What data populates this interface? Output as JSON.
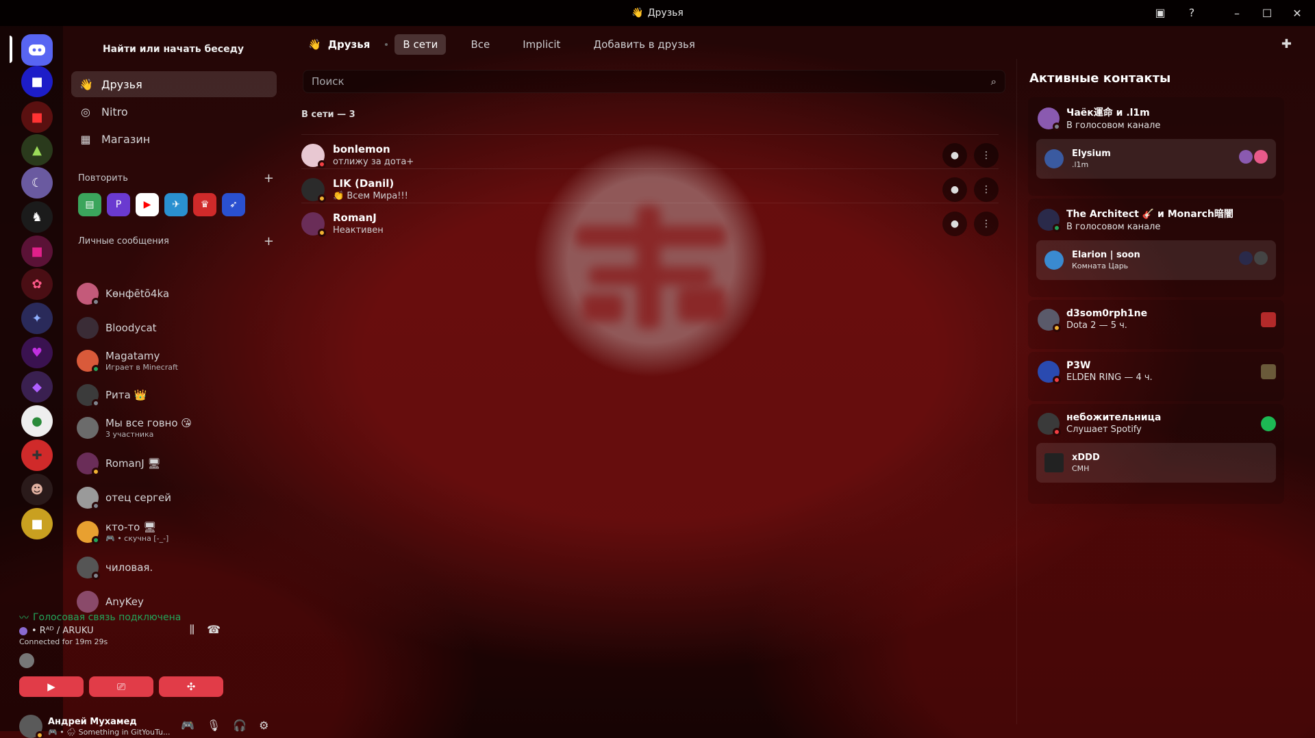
{
  "window": {
    "title": "Друзья"
  },
  "sidebar": {
    "search_label": "Найти или начать беседу",
    "nav": [
      {
        "label": "Друзья",
        "icon": "friends-icon"
      },
      {
        "label": "Nitro",
        "icon": "nitro-icon"
      },
      {
        "label": "Магазин",
        "icon": "shop-icon"
      }
    ],
    "recent_header": "Повторить",
    "dm_header": "Личные сообщения",
    "dms": [
      {
        "name": "Kөнфētō4ka",
        "sub": "",
        "status": "off",
        "color": "#c45a7a"
      },
      {
        "name": "Bloodycat",
        "sub": "",
        "status": "",
        "color": "#3a2c36"
      },
      {
        "name": "Magatamy",
        "sub": "Играет в Minecraft",
        "status": "online",
        "color": "#d95a3a"
      },
      {
        "name": "Рита 👑",
        "sub": "",
        "status": "off",
        "color": "#3b3b3b"
      },
      {
        "name": "Мы все говно 😘",
        "sub": "3 участника",
        "status": "",
        "color": "#6b6b6b"
      },
      {
        "name": "RomanJ 🖥",
        "sub": "",
        "status": "idle",
        "color": "#6a2d58"
      },
      {
        "name": "отец сергей",
        "sub": "",
        "status": "off",
        "color": "#9a9a9a"
      },
      {
        "name": "кто-то 🖥",
        "sub": "🎮 • скучна [-_-]",
        "status": "online",
        "color": "#e8a030"
      },
      {
        "name": "чиловая.",
        "sub": "",
        "status": "off",
        "color": "#555"
      },
      {
        "name": "AnyKey",
        "sub": "",
        "status": "",
        "color": "#8a4a6a"
      }
    ]
  },
  "voice": {
    "status": "Голосовая связь подключена",
    "channel": "• Rᴬᴰ / ARUKU",
    "duration": "Connected for 19m  29s"
  },
  "user": {
    "name": "Андрей Мухамед",
    "status": "🎮 • 🌧 Something in GitYouTu..."
  },
  "tabs": {
    "header": "Друзья",
    "items": [
      "В сети",
      "Все",
      "Implicit",
      "Добавить в друзья"
    ]
  },
  "main": {
    "search_placeholder": "Поиск",
    "count_label": "В сети — 3",
    "friends": [
      {
        "name": "bonlemon",
        "sub": "отлижу за дота+",
        "status": "dnd",
        "color": "#e8c8d2"
      },
      {
        "name": "LIK (Danil)",
        "sub": "👏 Всем Мира!!!",
        "status": "idle",
        "color": "#2b2b2b"
      },
      {
        "name": "RomanJ",
        "sub": "Неактивен",
        "status": "idle",
        "color": "#6a2d58"
      }
    ]
  },
  "active": {
    "title": "Активные контакты",
    "cards": [
      {
        "name": "Чаёк運命 и .l1m",
        "sub": "В голосовом канале",
        "inner_name": "Elysium",
        "inner_sub": ".l1m"
      },
      {
        "name": "The Architect 🎸 и Monarch暗闇",
        "sub": "В голосовом канале",
        "inner_name": "Elarion | soon",
        "inner_sub": "Комната Царь"
      },
      {
        "name": "d3som0rph1ne",
        "sub": "Dota 2 — 5 ч.",
        "inner_name": "",
        "inner_sub": ""
      },
      {
        "name": "P3W",
        "sub": "ELDEN RING — 4 ч.",
        "inner_name": "",
        "inner_sub": ""
      },
      {
        "name": "небожительница",
        "sub": "Слушает Spotify",
        "inner_name": "xDDD",
        "inner_sub": "CMH"
      }
    ]
  },
  "colors": {
    "accent_red": "#e13c48",
    "online": "#23a55a",
    "idle": "#f0b232",
    "dnd": "#f23f43",
    "offline": "#80848e",
    "spotify": "#1db954"
  }
}
